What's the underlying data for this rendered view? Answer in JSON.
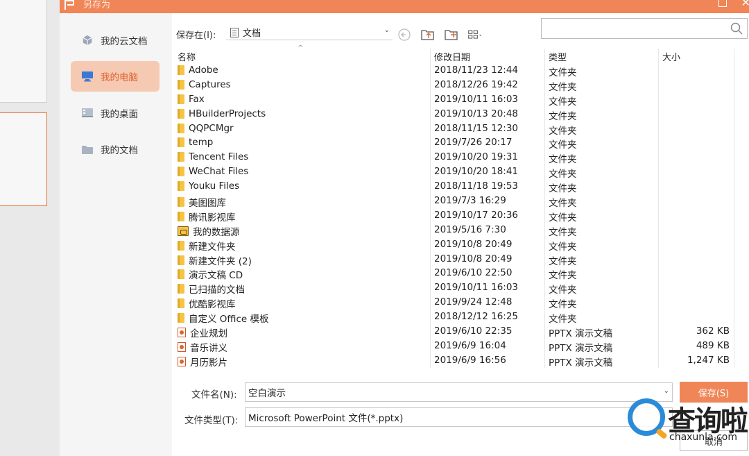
{
  "dialog": {
    "title": "另存为",
    "colors": {
      "accent": "#f08657",
      "active_bg": "#f5c9b2",
      "active_text": "#e0622c",
      "folder": "#f5c445"
    }
  },
  "sidebar": {
    "items": [
      {
        "label": "我的云文档",
        "icon": "cloud-cube-icon",
        "active": false
      },
      {
        "label": "我的电脑",
        "icon": "computer-icon",
        "active": true
      },
      {
        "label": "我的桌面",
        "icon": "desktop-icon",
        "active": false
      },
      {
        "label": "我的文档",
        "icon": "folder-icon",
        "active": false
      }
    ]
  },
  "location": {
    "label": "保存在(I):",
    "value": "文档"
  },
  "search": {
    "placeholder": ""
  },
  "columns": {
    "name": "名称",
    "date": "修改日期",
    "type": "类型",
    "size": "大小"
  },
  "files": [
    {
      "name": "Adobe",
      "date": "2018/11/23 12:44",
      "type": "文件夹",
      "size": "",
      "kind": "folder"
    },
    {
      "name": "Captures",
      "date": "2018/12/26 19:42",
      "type": "文件夹",
      "size": "",
      "kind": "folder"
    },
    {
      "name": "Fax",
      "date": "2019/10/11 16:03",
      "type": "文件夹",
      "size": "",
      "kind": "folder"
    },
    {
      "name": "HBuilderProjects",
      "date": "2019/10/13 20:48",
      "type": "文件夹",
      "size": "",
      "kind": "folder"
    },
    {
      "name": "QQPCMgr",
      "date": "2018/11/15 12:30",
      "type": "文件夹",
      "size": "",
      "kind": "folder"
    },
    {
      "name": "temp",
      "date": "2019/7/26 20:17",
      "type": "文件夹",
      "size": "",
      "kind": "folder"
    },
    {
      "name": "Tencent Files",
      "date": "2019/10/20 19:31",
      "type": "文件夹",
      "size": "",
      "kind": "folder"
    },
    {
      "name": "WeChat Files",
      "date": "2019/10/20 18:41",
      "type": "文件夹",
      "size": "",
      "kind": "folder"
    },
    {
      "name": "Youku Files",
      "date": "2018/11/18 19:53",
      "type": "文件夹",
      "size": "",
      "kind": "folder"
    },
    {
      "name": "美图图库",
      "date": "2019/7/3 16:29",
      "type": "文件夹",
      "size": "",
      "kind": "folder"
    },
    {
      "name": "腾讯影视库",
      "date": "2019/10/17 20:36",
      "type": "文件夹",
      "size": "",
      "kind": "folder"
    },
    {
      "name": "我的数据源",
      "date": "2019/5/16 7:30",
      "type": "文件夹",
      "size": "",
      "kind": "db"
    },
    {
      "name": "新建文件夹",
      "date": "2019/10/8 20:49",
      "type": "文件夹",
      "size": "",
      "kind": "folder"
    },
    {
      "name": "新建文件夹 (2)",
      "date": "2019/10/8 20:49",
      "type": "文件夹",
      "size": "",
      "kind": "folder"
    },
    {
      "name": "演示文稿 CD",
      "date": "2019/6/10 22:50",
      "type": "文件夹",
      "size": "",
      "kind": "folder"
    },
    {
      "name": "已扫描的文档",
      "date": "2019/10/11 16:03",
      "type": "文件夹",
      "size": "",
      "kind": "folder"
    },
    {
      "name": "优酷影视库",
      "date": "2019/9/24 12:48",
      "type": "文件夹",
      "size": "",
      "kind": "folder"
    },
    {
      "name": "自定义 Office 模板",
      "date": "2018/12/12 16:25",
      "type": "文件夹",
      "size": "",
      "kind": "folder"
    },
    {
      "name": "企业规划",
      "date": "2019/6/10 22:35",
      "type": "PPTX 演示文稿",
      "size": "362 KB",
      "kind": "pptx"
    },
    {
      "name": "音乐讲义",
      "date": "2019/6/9 16:04",
      "type": "PPTX 演示文稿",
      "size": "489 KB",
      "kind": "pptx"
    },
    {
      "name": "月历影片",
      "date": "2019/6/9 16:56",
      "type": "PPTX 演示文稿",
      "size": "1,247 KB",
      "kind": "pptx"
    }
  ],
  "form": {
    "filename_label": "文件名(N):",
    "filename_value": "空白演示",
    "filetype_label": "文件类型(T):",
    "filetype_value": "Microsoft PowerPoint 文件(*.pptx)",
    "save_label": "保存(S)",
    "cancel_label": "取消"
  },
  "watermark": {
    "text": "查询啦",
    "sub": "chaxunla.com"
  }
}
